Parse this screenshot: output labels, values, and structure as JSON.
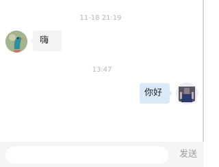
{
  "messages": [
    {
      "timestamp": "11-18 21:19",
      "side": "left",
      "text": "嗨",
      "avatar": "bird-avatar"
    },
    {
      "timestamp": "13:47",
      "side": "right",
      "text": "你好",
      "avatar": "user-photo-avatar"
    }
  ],
  "composer": {
    "placeholder": "",
    "value": "",
    "send_label": "发送"
  },
  "colors": {
    "timestamp": "#b5b5b5",
    "bubble_incoming": "#f3f3f3",
    "bubble_outgoing": "#dbeaf8",
    "send_disabled": "#9a9a9a",
    "composer_bar": "#f5f5f5"
  }
}
